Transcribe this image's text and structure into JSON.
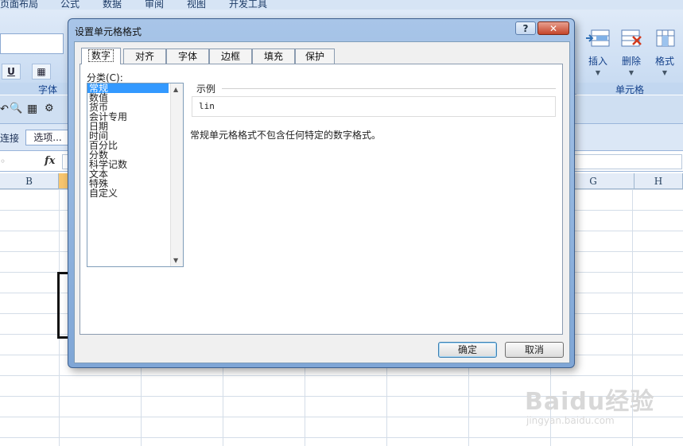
{
  "excel": {
    "menu": [
      "页面布局",
      "公式",
      "数据",
      "审阅",
      "视图",
      "开发工具"
    ],
    "ribbon_groups": {
      "font": "字体",
      "cells": "单元格"
    },
    "cells_buttons": [
      {
        "label": "插入",
        "icon": "insert-cells-icon"
      },
      {
        "label": "删除",
        "icon": "delete-cells-icon"
      },
      {
        "label": "格式",
        "icon": "format-cells-icon"
      }
    ],
    "format_buttons": {
      "underline": "U"
    },
    "connections_label": "连接",
    "options_button": "选项...",
    "fx_label": "fx",
    "columns": [
      "B",
      "G",
      "H"
    ]
  },
  "dialog": {
    "title": "设置单元格格式",
    "help_label": "?",
    "close_label": "✕",
    "tabs": [
      "数字",
      "对齐",
      "字体",
      "边框",
      "填充",
      "保护"
    ],
    "active_tab": "数字",
    "category_label": "分类(C):",
    "categories": [
      "常规",
      "数值",
      "货币",
      "会计专用",
      "日期",
      "时间",
      "百分比",
      "分数",
      "科学记数",
      "文本",
      "特殊",
      "自定义"
    ],
    "selected_category": "常规",
    "sample_label": "示例",
    "sample_value": "lin",
    "description": "常规单元格格式不包含任何特定的数字格式。",
    "ok_label": "确定",
    "cancel_label": "取消"
  },
  "watermark": {
    "text": "Baidu经验",
    "url": "jingyan.baidu.com"
  },
  "colors": {
    "selection": "#3399ff",
    "ribbon": "#c5d9f1",
    "close_button": "#c5452a"
  }
}
